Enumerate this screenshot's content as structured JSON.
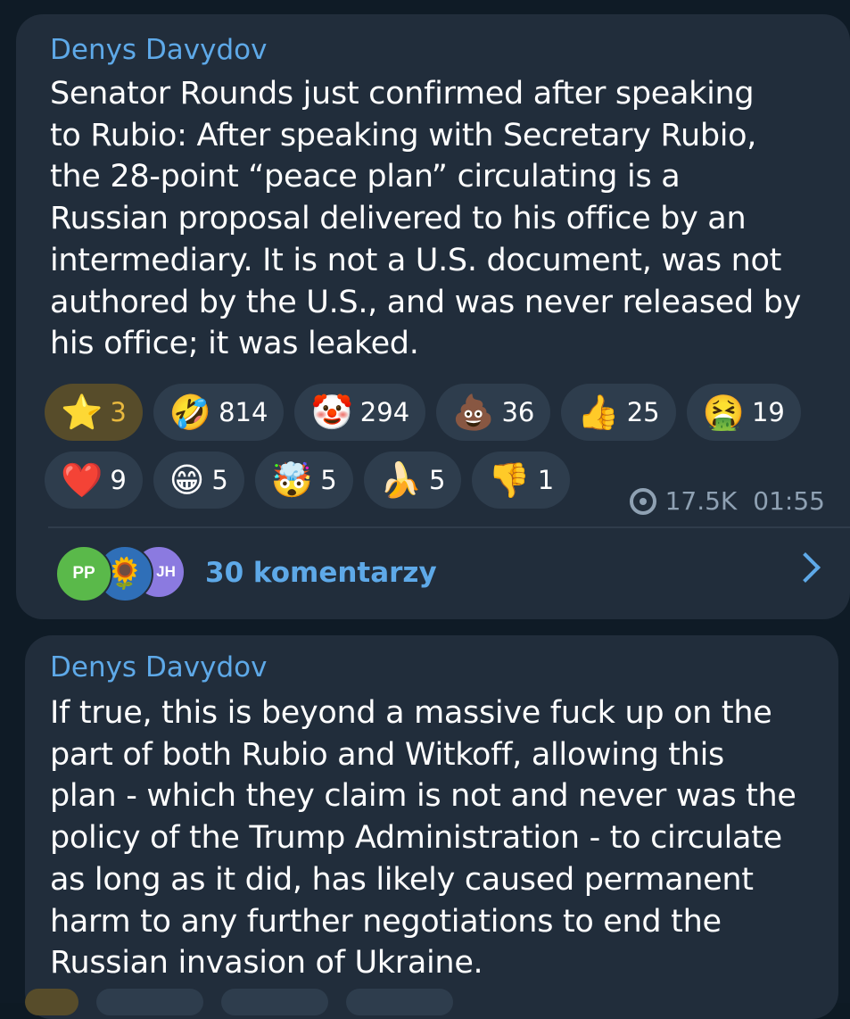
{
  "messages": [
    {
      "sender": "Denys Davydov",
      "text": "Senator Rounds just confirmed after speaking\nto Rubio: After speaking with Secretary Rubio,\nthe 28-point “peace plan” circulating is a\nRussian proposal delivered to his office by an\nintermediary. It is not a U.S. document, was not\nauthored by the U.S., and was never released by\nhis office; it was leaked.",
      "reactions_row1": [
        {
          "emoji": "⭐",
          "icon": "star-icon",
          "count": "3"
        },
        {
          "emoji": "🤣",
          "icon": "rofl-icon",
          "count": "814"
        },
        {
          "emoji": "🤡",
          "icon": "clown-icon",
          "count": "294"
        },
        {
          "emoji": "💩",
          "icon": "poop-icon",
          "count": "36"
        },
        {
          "emoji": "👍",
          "icon": "thumbs-up-icon",
          "count": "25"
        },
        {
          "emoji": "🤮",
          "icon": "vomit-icon",
          "count": "19"
        }
      ],
      "reactions_row2": [
        {
          "emoji": "❤️",
          "icon": "heart-icon",
          "count": "9"
        },
        {
          "emoji": "😁",
          "icon": "grin-icon",
          "count": "5"
        },
        {
          "emoji": "🤯",
          "icon": "mind-blown-icon",
          "count": "5"
        },
        {
          "emoji": "🍌",
          "icon": "banana-icon",
          "count": "5"
        },
        {
          "emoji": "👎",
          "icon": "thumbs-down-icon",
          "count": "1"
        }
      ],
      "views": "17.5K",
      "time": "01:55",
      "comments_label": "30 komentarzy",
      "avatars": [
        "PP",
        "🌻",
        "JH"
      ]
    },
    {
      "sender": "Denys Davydov",
      "text": "If true, this is beyond a massive fuck up on the\npart of both Rubio and Witkoff, allowing this\nplan - which they claim is not and never was the\npolicy of the Trump Administration - to circulate\nas long as it did, has likely caused permanent\nharm to any further negotiations to end the\nRussian invasion of Ukraine."
    }
  ],
  "colors": {
    "background": "#0f1b26",
    "bubble": "#212d3b",
    "accent": "#5ea9e8",
    "chip": "#2e3d4d",
    "chip_selected": "#574c2a"
  }
}
